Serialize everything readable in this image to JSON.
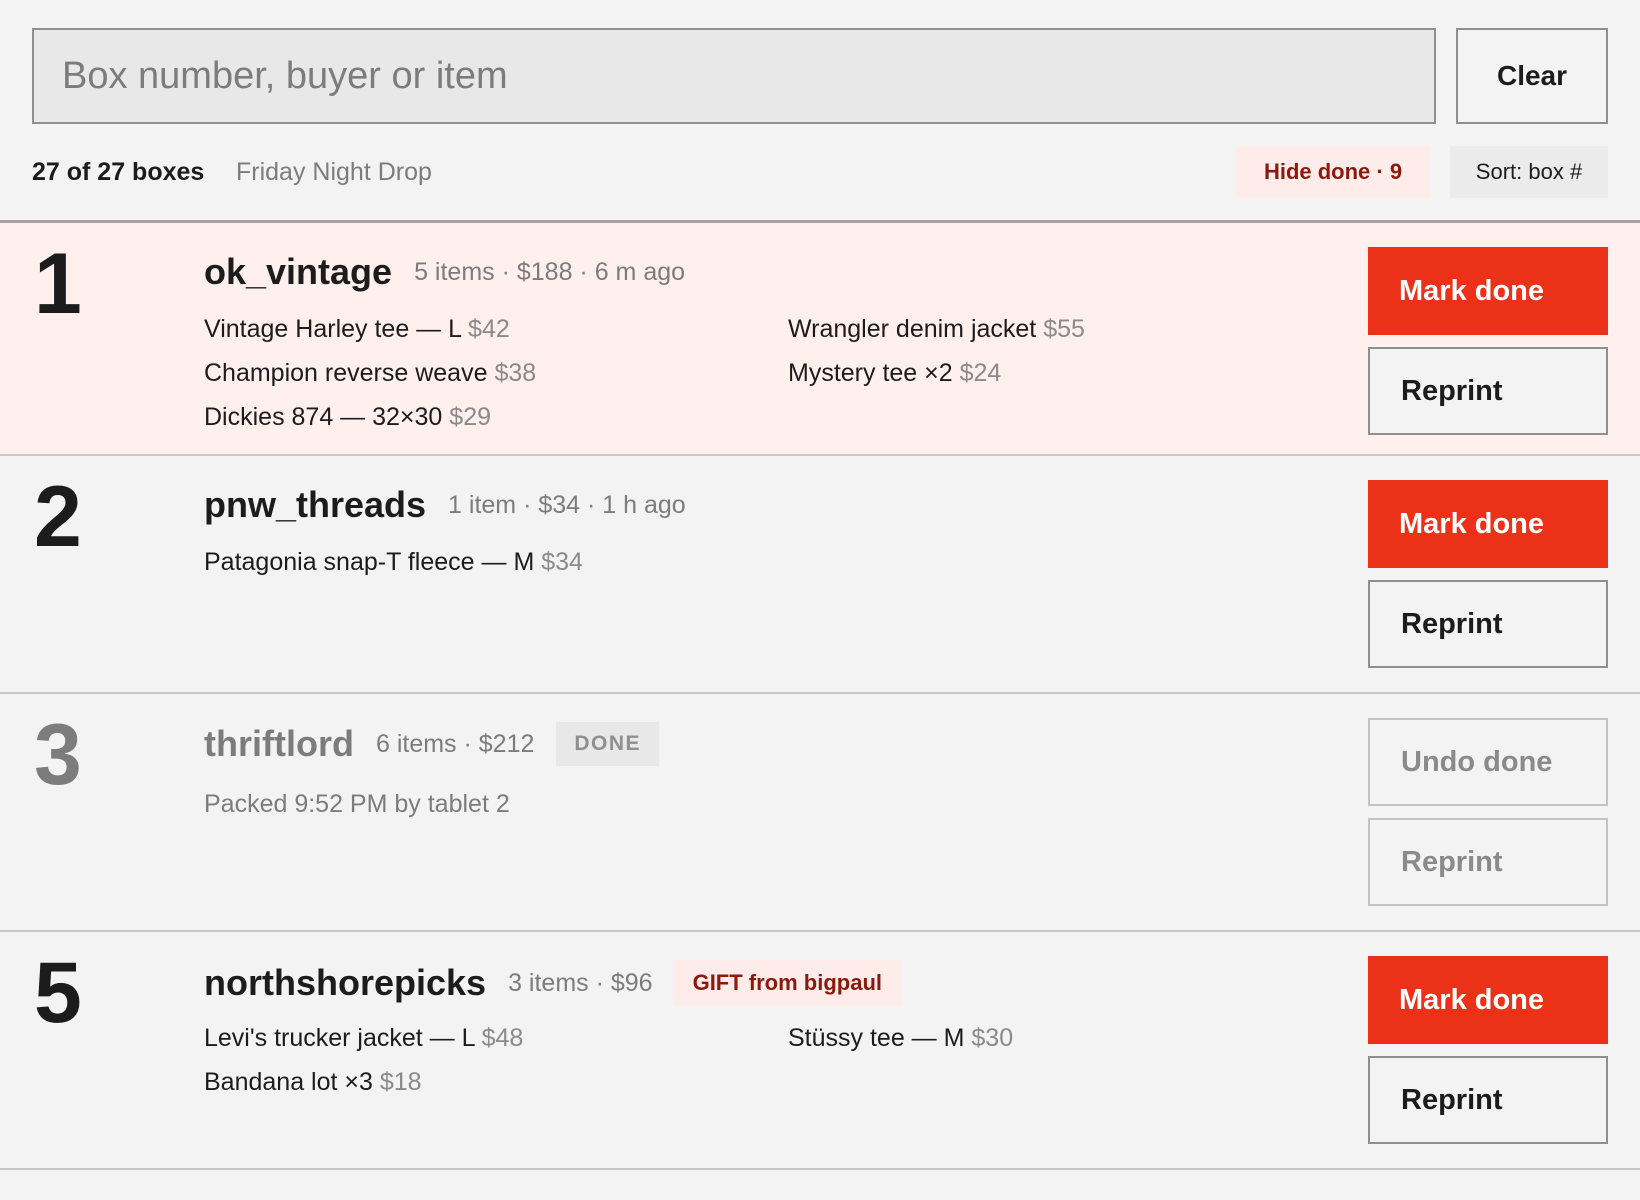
{
  "search": {
    "placeholder": "Box number, buyer or item",
    "value": ""
  },
  "clear_label": "Clear",
  "status": {
    "count": "27 of 27 boxes",
    "event": "Friday Night Drop",
    "hide_done": "Hide done · 9",
    "sort": "Sort: box #"
  },
  "colors": {
    "accent": "#eb3118",
    "highlight_bg": "#fff0ee",
    "badge_text": "#8b1a0c"
  },
  "rows": [
    {
      "box": "1",
      "buyer": "ok_vintage",
      "summary": "5 items · $188 · 6 m ago",
      "state": "highlight",
      "items": [
        {
          "name": "Vintage Harley tee — L",
          "price": "$42"
        },
        {
          "name": "Wrangler denim jacket",
          "price": "$55"
        },
        {
          "name": "Champion reverse weave",
          "price": "$38"
        },
        {
          "name": "Mystery tee ×2",
          "price": "$24"
        },
        {
          "name": "Dickies 874 — 32×30",
          "price": "$29"
        }
      ],
      "primary": "Mark done",
      "secondary": "Reprint"
    },
    {
      "box": "2",
      "buyer": "pnw_threads",
      "summary": "1 item · $34 · 1 h ago",
      "state": "open",
      "items": [
        {
          "name": "Patagonia snap-T fleece — M",
          "price": "$34"
        }
      ],
      "primary": "Mark done",
      "secondary": "Reprint"
    },
    {
      "box": "3",
      "buyer": "thriftlord",
      "summary": "6 items · $212",
      "state": "done",
      "badge": "DONE",
      "packed": "Packed 9:52 PM by tablet 2",
      "primary": "Undo done",
      "secondary": "Reprint"
    },
    {
      "box": "5",
      "buyer": "northshorepicks",
      "summary": "3 items · $96",
      "state": "open",
      "gift": "GIFT from bigpaul",
      "items": [
        {
          "name": "Levi's trucker jacket — L",
          "price": "$48"
        },
        {
          "name": "Stüssy tee — M",
          "price": "$30"
        },
        {
          "name": "Bandana lot ×3",
          "price": "$18"
        }
      ],
      "primary": "Mark done",
      "secondary": "Reprint"
    }
  ]
}
